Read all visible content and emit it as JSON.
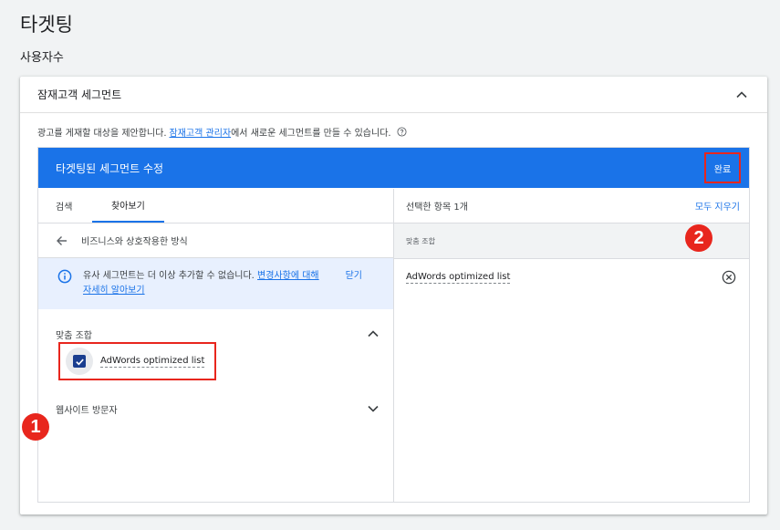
{
  "page": {
    "title": "타겟팅",
    "subtitle": "사용자수"
  },
  "card": {
    "header_title": "잠재고객 세그먼트",
    "desc_prefix": "광고를 게재할 대상을 제안합니다.",
    "desc_link": "잠재고객 관리자",
    "desc_suffix": "에서 새로운 세그먼트를 만들 수 있습니다."
  },
  "editor": {
    "title": "타겟팅된 세그먼트 수정",
    "done_label": "완료",
    "tabs": [
      {
        "label": "검색"
      },
      {
        "label": "찾아보기"
      }
    ],
    "breadcrumb": "비즈니스와 상호작용한 방식",
    "banner": {
      "text_prefix": "유사 세그먼트는 더 이상 추가할 수 없습니다.",
      "link": "변경사항에 대해 자세히 알아보기",
      "close_label": "닫기"
    },
    "sections": [
      {
        "label": "맞춤 조합",
        "expanded": true
      },
      {
        "label": "웹사이트 방문자",
        "expanded": false
      }
    ],
    "checkbox_item": {
      "label": "AdWords optimized list",
      "checked": true
    },
    "right": {
      "selected_count": "선택한 항목 1개",
      "clear_all": "모두 지우기",
      "group_label": "맞춤 조합",
      "selected_item": "AdWords optimized list"
    }
  },
  "badges": {
    "one": "1",
    "two": "2"
  },
  "colors": {
    "accent": "#1a73e8",
    "highlight": "#e8261d",
    "banner_bg": "#e8f0fe"
  }
}
